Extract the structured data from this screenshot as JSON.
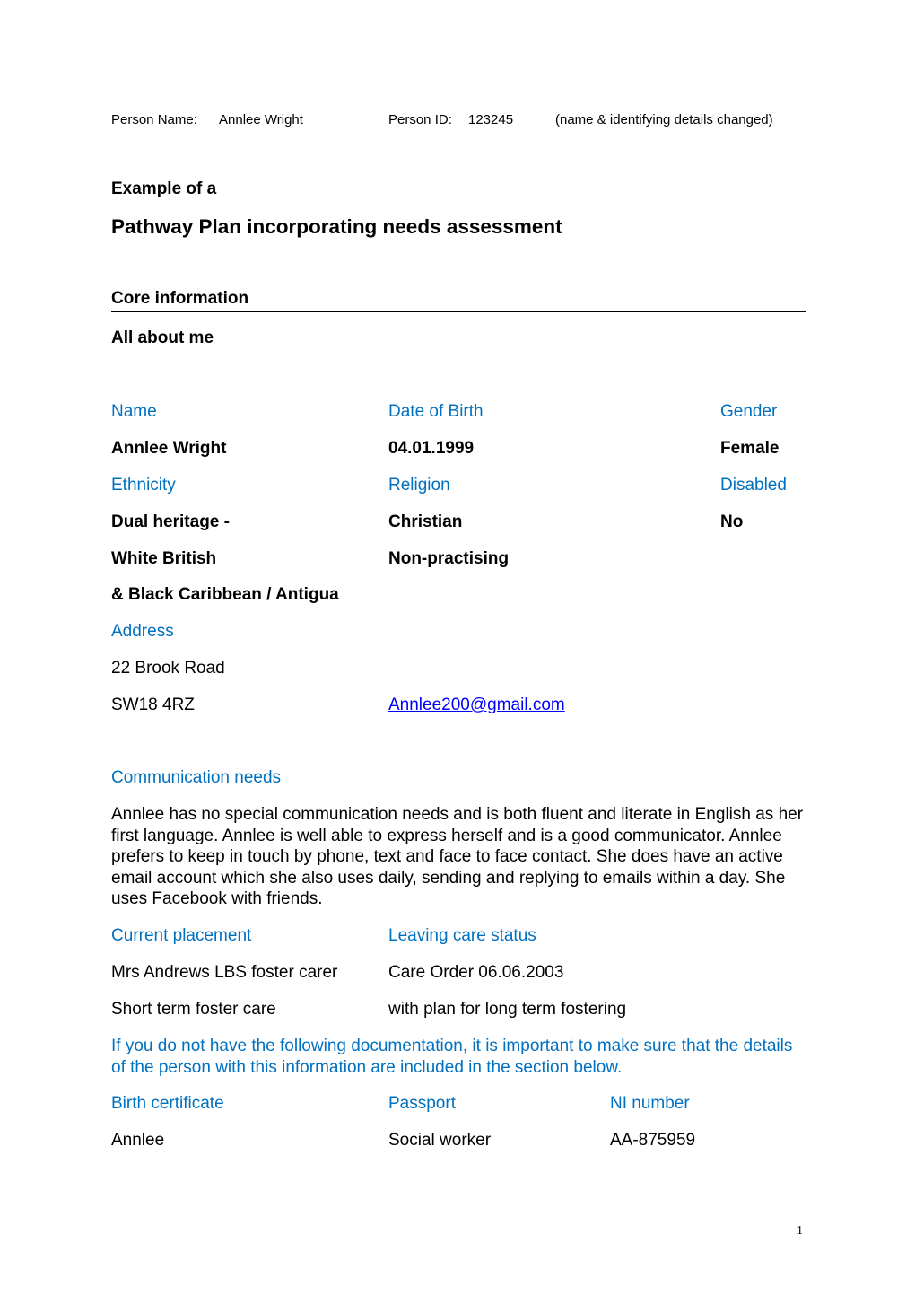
{
  "header": {
    "person_name_label": "Person Name:",
    "person_name": "Annlee Wright",
    "person_id_label": "Person ID:",
    "person_id": "123245",
    "note": "(name & identifying details changed)"
  },
  "title": {
    "pre": "Example of a",
    "main": "Pathway Plan incorporating needs assessment"
  },
  "section": {
    "heading": "Core information",
    "subheading": "All about me"
  },
  "fields": {
    "name_label": "Name",
    "name_value": "Annlee Wright",
    "dob_label": "Date of Birth",
    "dob_value": "04.01.1999",
    "gender_label": "Gender",
    "gender_value": "Female",
    "ethnicity_label": "Ethnicity",
    "ethnicity_lines": [
      "Dual heritage -",
      "White British",
      "& Black Caribbean / Antigua"
    ],
    "religion_label": "Religion",
    "religion_lines": [
      "Christian",
      "Non-practising"
    ],
    "disabled_label": "Disabled",
    "disabled_value": "No",
    "address_label": "Address",
    "address_lines": [
      "22 Brook Road",
      "SW18 4RZ"
    ],
    "email": "Annlee200@gmail.com"
  },
  "communication": {
    "label": "Communication needs",
    "text": "Annlee has no special communication needs and is both fluent and literate in English as her first language.  Annlee is well able to express herself and is a good communicator.  Annlee prefers to keep in touch by phone, text and face to face contact.  She does have an active email account which she also uses daily, sending and replying to emails within a day.  She uses Facebook with friends."
  },
  "placement": {
    "current_label": "Current placement",
    "current_lines": [
      "Mrs Andrews LBS foster carer",
      "Short term foster care"
    ],
    "status_label": "Leaving care status",
    "status_lines": [
      "Care Order 06.06.2003",
      "with plan for long term fostering"
    ]
  },
  "documentation": {
    "note": "If you do not have the following documentation, it is important to make sure that the details of the person with this information are included in the section below.",
    "birth_cert_label": "Birth certificate",
    "birth_cert_value": "Annlee",
    "passport_label": "Passport",
    "passport_value": "Social worker",
    "ni_label": "NI number",
    "ni_value": "AA-875959"
  },
  "footer": {
    "page_number": "1"
  },
  "colors": {
    "label_blue": "#0070C0",
    "link_blue": "#0000FF",
    "text": "#000000"
  }
}
